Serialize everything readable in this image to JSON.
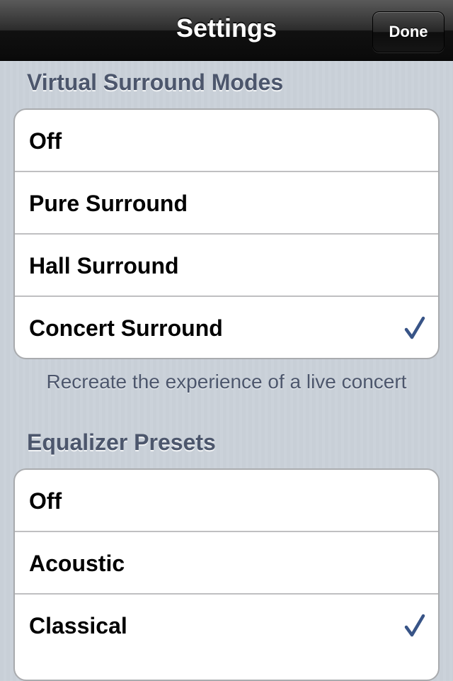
{
  "navbar": {
    "title": "Settings",
    "done_label": "Done"
  },
  "surround": {
    "header": "Virtual Surround Modes",
    "items": [
      {
        "label": "Off",
        "checked": false
      },
      {
        "label": "Pure Surround",
        "checked": false
      },
      {
        "label": "Hall Surround",
        "checked": false
      },
      {
        "label": "Concert Surround",
        "checked": true
      }
    ],
    "footer": "Recreate the experience of a live concert"
  },
  "equalizer": {
    "header": "Equalizer Presets",
    "items": [
      {
        "label": "Off",
        "checked": false
      },
      {
        "label": "Acoustic",
        "checked": false
      },
      {
        "label": "Classical",
        "checked": true
      }
    ]
  },
  "icons": {
    "checkmark": "checkmark-icon"
  },
  "colors": {
    "checkmark": "#385487",
    "section_header": "#4c566c",
    "navbar": "#1a1a1a",
    "background": "#c5ccd4"
  }
}
